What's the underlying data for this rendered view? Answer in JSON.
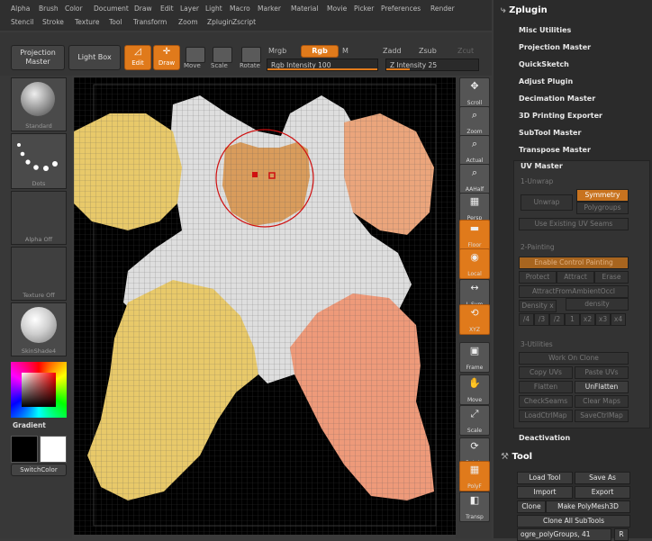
{
  "menu": [
    "Alpha",
    "Brush",
    "Color",
    "Document",
    "Draw",
    "Edit",
    "Layer",
    "Light",
    "Macro",
    "Marker",
    "Material",
    "Movie",
    "Picker",
    "Preferences",
    "Render",
    "Stencil",
    "Stroke",
    "Texture",
    "Tool",
    "Transform",
    "Zoom",
    "Zplugin",
    "Zscript"
  ],
  "toolbar": {
    "projection_master": "Projection Master",
    "light_box": "Light Box",
    "edit": "Edit",
    "draw": "Draw",
    "move": "Move",
    "scale": "Scale",
    "rotate": "Rotate",
    "mrgb": "Mrgb",
    "rgb": "Rgb",
    "m": "M",
    "zadd": "Zadd",
    "zsub": "Zsub",
    "zcut": "Zcut",
    "rgb_intensity_label": "Rgb Intensity 100",
    "rgb_intensity_value": 100,
    "z_intensity_label": "Z Intensity 25",
    "z_intensity_value": 25
  },
  "left_shelf": {
    "standard": "Standard",
    "dots": "Dots",
    "alpha_off": "Alpha Off",
    "texture_off": "Texture Off",
    "skin_shade": "SkinShade4",
    "gradient": "Gradient",
    "switch_color": "SwitchColor"
  },
  "right_shelf": [
    {
      "name": "scroll",
      "label": "Scroll",
      "glyph": "✥",
      "active": false
    },
    {
      "name": "zoom",
      "label": "Zoom",
      "glyph": "⌕",
      "active": false
    },
    {
      "name": "actual",
      "label": "Actual",
      "glyph": "⌕",
      "active": false
    },
    {
      "name": "aahalf",
      "label": "AAHalf",
      "glyph": "⌕",
      "active": false
    },
    {
      "name": "persp",
      "label": "Persp",
      "glyph": "▦",
      "active": false
    },
    {
      "name": "floor",
      "label": "Floor",
      "glyph": "▬",
      "active": true
    },
    {
      "name": "local",
      "label": "Local",
      "glyph": "◉",
      "active": true
    },
    {
      "name": "lsym",
      "label": "L.Sym",
      "glyph": "↔",
      "active": false
    },
    {
      "name": "xyz",
      "label": "XYZ",
      "glyph": "⟲",
      "active": true
    },
    {
      "name": "frame",
      "label": "Frame",
      "glyph": "▣",
      "active": false
    },
    {
      "name": "move",
      "label": "Move",
      "glyph": "✋",
      "active": false
    },
    {
      "name": "scale",
      "label": "Scale",
      "glyph": "⤢",
      "active": false
    },
    {
      "name": "rotate",
      "label": "Rotate",
      "glyph": "⟳",
      "active": false
    },
    {
      "name": "polyf",
      "label": "PolyF",
      "glyph": "▦",
      "active": true
    },
    {
      "name": "transp",
      "label": "Transp",
      "glyph": "◧",
      "active": false
    }
  ],
  "panel": {
    "zplugin_title": "Zplugin",
    "items": [
      "Misc Utilities",
      "Projection Master",
      "QuickSketch",
      "Adjust Plugin",
      "Decimation Master",
      "3D Printing Exporter",
      "SubTool Master",
      "Transpose Master"
    ],
    "uv_master": {
      "title": "UV Master",
      "unwrap_section": "1-Unwrap",
      "unwrap": "Unwrap",
      "symmetry": "Symmetry",
      "polygroups": "Polygroups",
      "use_existing": "Use Existing UV Seams",
      "painting_section": "2-Painting",
      "enable_control": "Enable Control Painting",
      "protect": "Protect",
      "attract": "Attract",
      "erase": "Erase",
      "attract_ao": "AttractFromAmbientOccl",
      "density": "Density",
      "density_x": "x",
      "density_slider": "density",
      "density_values": [
        "/4",
        "/3",
        "/2",
        "1",
        "x2",
        "x3",
        "x4"
      ],
      "utilities_section": "3-Utilities",
      "work_on_clone": "Work On Clone",
      "copy_uvs": "Copy UVs",
      "paste_uvs": "Paste UVs",
      "flatten": "Flatten",
      "unflatten": "UnFlatten",
      "checkseams": "CheckSeams",
      "clear_maps": "Clear Maps",
      "load_ctrl": "LoadCtrlMap",
      "save_ctrl": "SaveCtrlMap"
    },
    "deactivation": "Deactivation",
    "tool_title": "Tool",
    "load_tool": "Load Tool",
    "save_as": "Save As",
    "import": "Import",
    "export": "Export",
    "clone": "Clone",
    "make_polymesh": "Make PolyMesh3D",
    "clone_all": "Clone All SubTools",
    "subtool_name": "ogre_polyGroups",
    "subtool_count": "41",
    "r": "R"
  },
  "colors": {
    "accent": "#e07a1b",
    "uv_yellow": "#e8c96a",
    "uv_orange": "#eba57c",
    "uv_salmon": "#ee9a7a",
    "uv_white": "#dedede",
    "uv_face": "#d99c5c"
  }
}
